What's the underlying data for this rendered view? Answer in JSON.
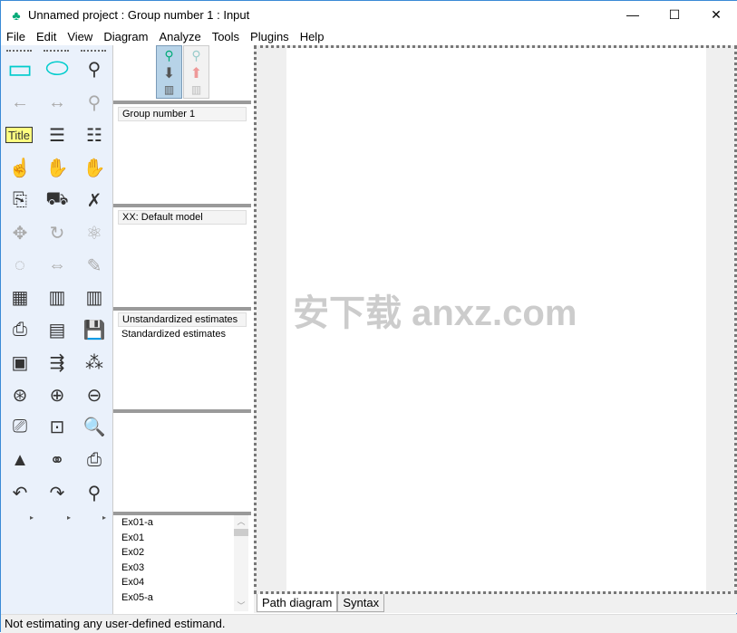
{
  "window": {
    "title": "Unnamed project : Group number 1 : Input",
    "minimize": "—",
    "maximize": "☐",
    "close": "✕"
  },
  "menu": [
    "File",
    "Edit",
    "View",
    "Diagram",
    "Analyze",
    "Tools",
    "Plugins",
    "Help"
  ],
  "toolbar": {
    "icons": [
      [
        "draw-observed-variable-icon",
        "draw-unobserved-variable-icon",
        "draw-latent-indicator-icon"
      ],
      [
        "draw-path-icon",
        "draw-covariance-icon",
        "add-unique-variable-icon"
      ],
      [
        "figure-caption-icon",
        "list-model-variables-icon",
        "list-dataset-variables-icon"
      ],
      [
        "select-one-icon",
        "select-all-icon",
        "deselect-all-icon"
      ],
      [
        "duplicate-icon",
        "move-icon",
        "erase-icon"
      ],
      [
        "change-shape-icon",
        "rotate-indicators-icon",
        "reflect-indicators-icon"
      ],
      [
        "move-parameters-icon",
        "scroll-icon",
        "touch-up-icon"
      ],
      [
        "data-files-icon",
        "analysis-properties-icon",
        "calculate-estimates-icon"
      ],
      [
        "copy-to-clipboard-icon",
        "text-output-icon",
        "save-icon"
      ],
      [
        "object-properties-icon",
        "drag-properties-icon",
        "preserve-symmetries-icon"
      ],
      [
        "zoom-area-icon",
        "zoom-in-icon",
        "zoom-out-icon"
      ],
      [
        "page-view-icon",
        "fit-to-page-icon",
        "magnify-icon"
      ],
      [
        "bayesian-icon",
        "multiple-group-icon",
        "print-icon"
      ],
      [
        "undo-icon",
        "redo-icon",
        "specification-search-icon"
      ]
    ],
    "glyphs": [
      [
        "▭",
        "⬭",
        "⚲"
      ],
      [
        "←",
        "↔",
        "⚲"
      ],
      [
        "Title",
        "☰",
        "☷"
      ],
      [
        "☝",
        "✋",
        "✋"
      ],
      [
        "⎘",
        "⛟",
        "✗"
      ],
      [
        "✥",
        "↻",
        "⚛"
      ],
      [
        "◌",
        "⇔",
        "✎"
      ],
      [
        "▦",
        "▥",
        "▥"
      ],
      [
        "⎙",
        "▤",
        "💾"
      ],
      [
        "▣",
        "⇶",
        "⁂"
      ],
      [
        "⊛",
        "⊕",
        "⊖"
      ],
      [
        "⎚",
        "⊡",
        "🔍"
      ],
      [
        "▲",
        "⚭",
        "⎙"
      ],
      [
        "↶",
        "↷",
        "⚲"
      ]
    ]
  },
  "panels": {
    "groups": {
      "header": "Group number 1"
    },
    "models": {
      "header": "XX: Default model"
    },
    "estimates": {
      "header": "Unstandardized estimates",
      "items": [
        "Standardized estimates"
      ]
    },
    "files": [
      "Ex01-a",
      "Ex01",
      "Ex02",
      "Ex03",
      "Ex04",
      "Ex05-a"
    ]
  },
  "tabs": [
    "Path diagram",
    "Syntax"
  ],
  "status": "Not estimating any user-defined estimand.",
  "watermark": "安下载 anxz.com",
  "colors": {
    "accent": "#00e0e0",
    "toolbar_bg": "#eaf1fb"
  }
}
